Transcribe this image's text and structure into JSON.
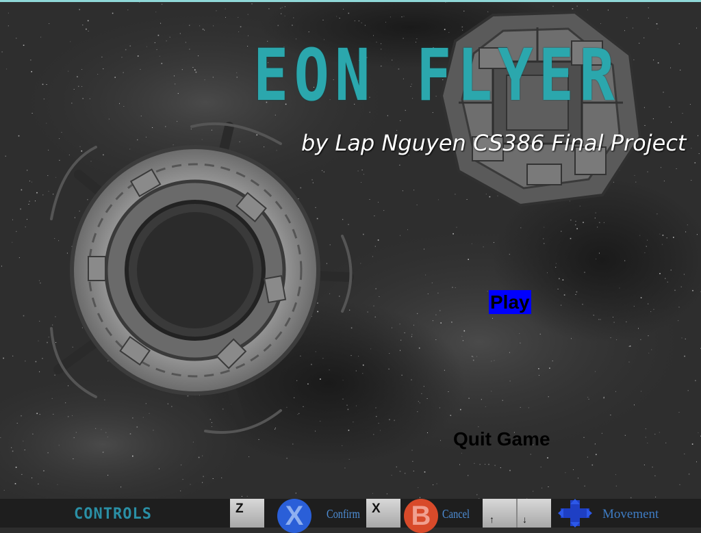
{
  "title": {
    "game_name": "EON FLYER",
    "byline": "by Lap Nguyen CS386 Final Project"
  },
  "menu": {
    "play": "Play",
    "quit": "Quit Game",
    "selected": "Play"
  },
  "controls": {
    "heading": "CONTROLS",
    "confirm_key": "Z",
    "confirm_button": "X",
    "confirm_label": "Confirm",
    "cancel_key": "X",
    "cancel_button": "B",
    "cancel_label": "Cancel",
    "move_keys": [
      "↑",
      "↓"
    ],
    "move_label": "Movement"
  },
  "colors": {
    "title": "#2ba7ad",
    "menu_highlight": "#0000ff",
    "controls_text": "#2a8fa5"
  },
  "icons": [
    "ring-space-station",
    "octagonal-space-station",
    "dpad-icon"
  ]
}
